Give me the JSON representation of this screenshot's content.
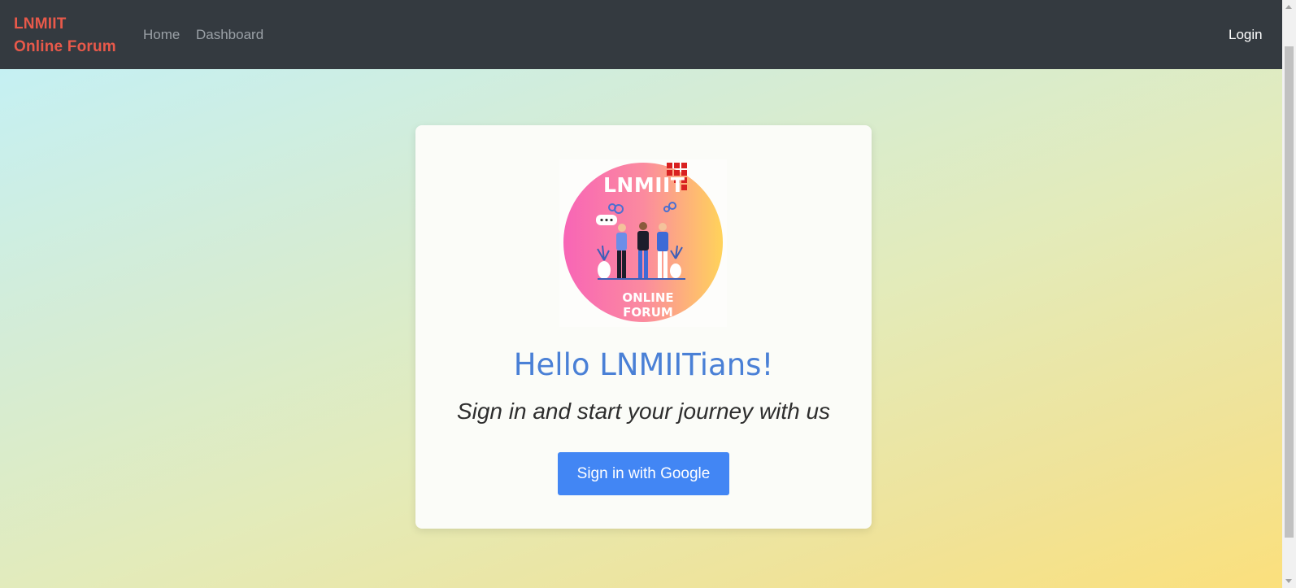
{
  "navbar": {
    "brand_line1": "LNMIIT",
    "brand_line2": "Online Forum",
    "links": [
      {
        "label": "Home"
      },
      {
        "label": "Dashboard"
      }
    ],
    "login_label": "Login"
  },
  "card": {
    "logo": {
      "top_text": "LNMIIT",
      "bottom_text": "ONLINE FORUM"
    },
    "heading": "Hello LNMIITians!",
    "subheading": "Sign in and start your journey with us",
    "signin_button": "Sign in with Google"
  },
  "colors": {
    "navbar_bg": "#343a40",
    "brand": "#e8594a",
    "heading": "#4a80d6",
    "button": "#4286f4"
  }
}
